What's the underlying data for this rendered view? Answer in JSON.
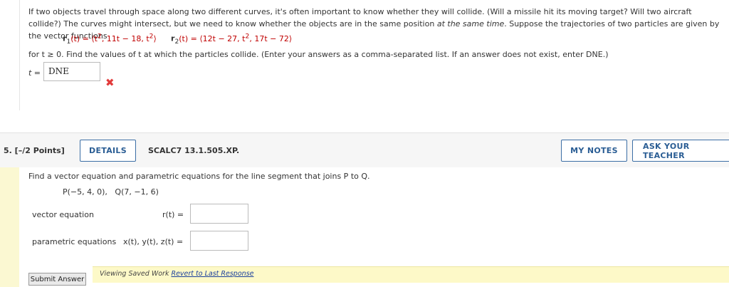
{
  "q4": {
    "intro_a": "If two objects travel through space along two different curves, it's often important to know whether they will collide. (Will a missile hit its moving target? Will two aircraft collide?) The curves might intersect, but we need to know whether the objects are in the same position ",
    "intro_em": "at the same time",
    "intro_b": ". Suppose the trajectories of two particles are given by the vector functions",
    "r1_label": "r",
    "r1_sub": "1",
    "r1_pre": "(t) = ⟨t",
    "r1_sup": "2",
    "r1_comp2": ", 11t − 18, t",
    "r1_sup2": "2",
    "r1_close": "⟩",
    "r2_label": "r",
    "r2_sub": "2",
    "r2_pre": "(t) = ⟨12t − 27, t",
    "r2_sup": "2",
    "r2_post": ", 17t − 72⟩",
    "for_line": "for t ≥ 0.  Find the values of t at which the particles collide. (Enter your answers as a comma-separated list. If an answer does not exist, enter DNE.)",
    "answer_label": "t =",
    "answer_value": "DNE",
    "answer_mark": "✖"
  },
  "q5": {
    "number": "5.  [–/2 Points]",
    "details_label": "DETAILS",
    "code": "SCALC7 13.1.505.XP.",
    "my_notes_label": "MY NOTES",
    "ask_teacher_label": "ASK YOUR TEACHER",
    "prompt": "Find a vector equation and parametric equations for the line segment that joins P to Q.",
    "points_P": "P(−5, 4, 0),",
    "points_Q": "Q(7, −1, 6)",
    "row1_label": "vector equation",
    "row1_eq": "r(t)  =",
    "row2_label": "parametric equations",
    "row2_eq": "x(t), y(t), z(t)  =",
    "submit_label": "Submit Answer",
    "saved_text": "Viewing Saved Work ",
    "revert_link": "Revert to Last Response"
  },
  "colors": {
    "accent": "#2a5d94",
    "error": "#e23b3b",
    "highlight": "#fdf9c8",
    "side": "#fbf8d2"
  }
}
